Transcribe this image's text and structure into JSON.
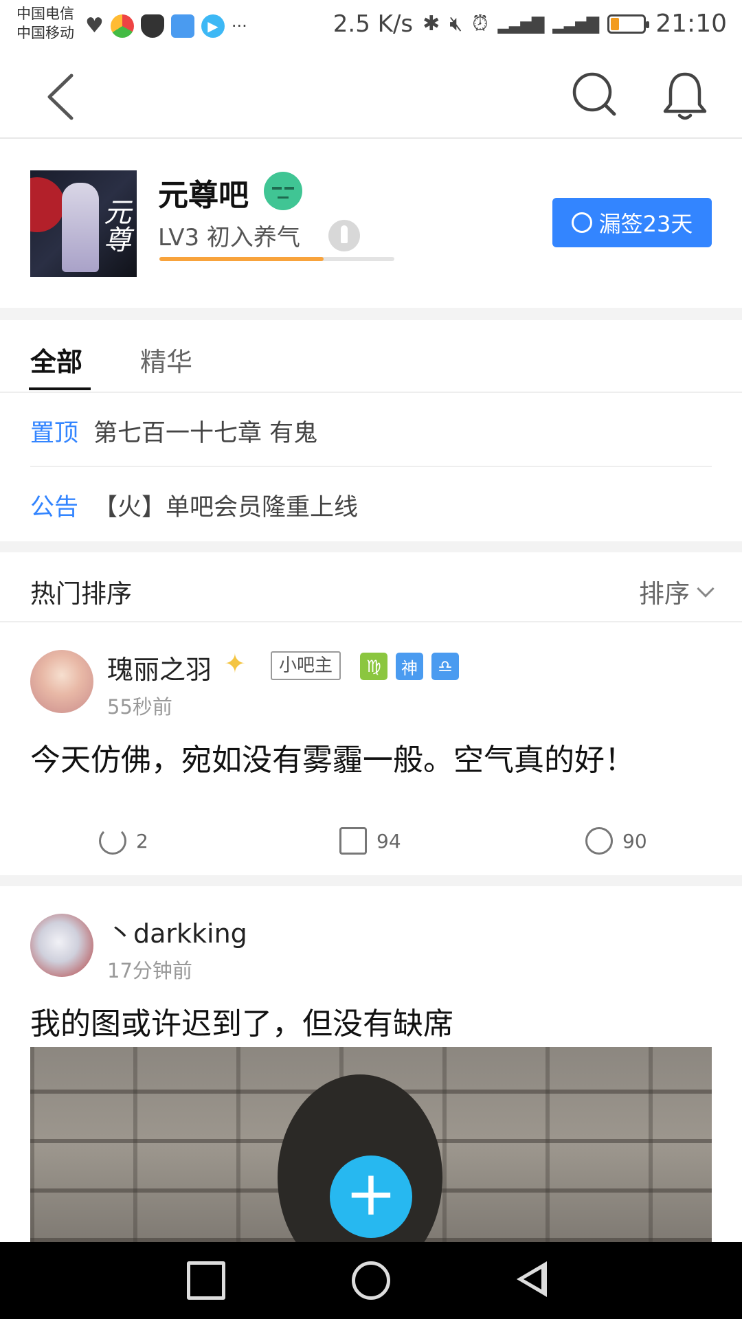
{
  "status_bar": {
    "carrier_1": "中国电信",
    "carrier_2": "中国移动",
    "speed": "2.5 K/s",
    "time": "21:10",
    "icons": [
      "heartbeat-icon",
      "chrome-icon",
      "shield-icon",
      "card-icon",
      "video-icon",
      "more-icon",
      "bluetooth-icon",
      "mute-icon",
      "alarm-icon",
      "signal-4g-icon",
      "signal-2g-icon",
      "battery-icon"
    ],
    "more_glyph": "···"
  },
  "nav": {
    "back_icon": "back-chevron-icon",
    "search_icon": "search-icon",
    "bell_icon": "bell-icon"
  },
  "forum": {
    "name": "元尊吧",
    "level_text": "LV3 初入养气",
    "xp_progress": 0.7,
    "sign_button": "漏签23天",
    "accent": "#3385ff"
  },
  "tabs": [
    {
      "label": "全部",
      "active": true
    },
    {
      "label": "精华",
      "active": false
    }
  ],
  "pinned": [
    {
      "tag": "置顶",
      "text": "第七百一十七章 有鬼"
    },
    {
      "tag": "公告",
      "text": "【火】单吧会员隆重上线"
    }
  ],
  "sort": {
    "title": "热门排序",
    "button": "排序"
  },
  "posts": [
    {
      "username": "瑰丽之羽",
      "time": "55秒前",
      "role_badge": "小吧主",
      "badges": [
        {
          "glyph": "♍",
          "color": "#8bc63f"
        },
        {
          "glyph": "神",
          "color": "#4a9bf0"
        },
        {
          "glyph": "♎",
          "color": "#4a9bf0"
        }
      ],
      "content": "今天仿佛，宛如没有雾霾一般。空气真的好！",
      "shares": "2",
      "comments": "94",
      "likes": "90"
    },
    {
      "username": "丶darkking",
      "time": "17分钟前",
      "content": "我的图或许迟到了，但没有缺席"
    }
  ],
  "fab": {
    "label": "+"
  }
}
